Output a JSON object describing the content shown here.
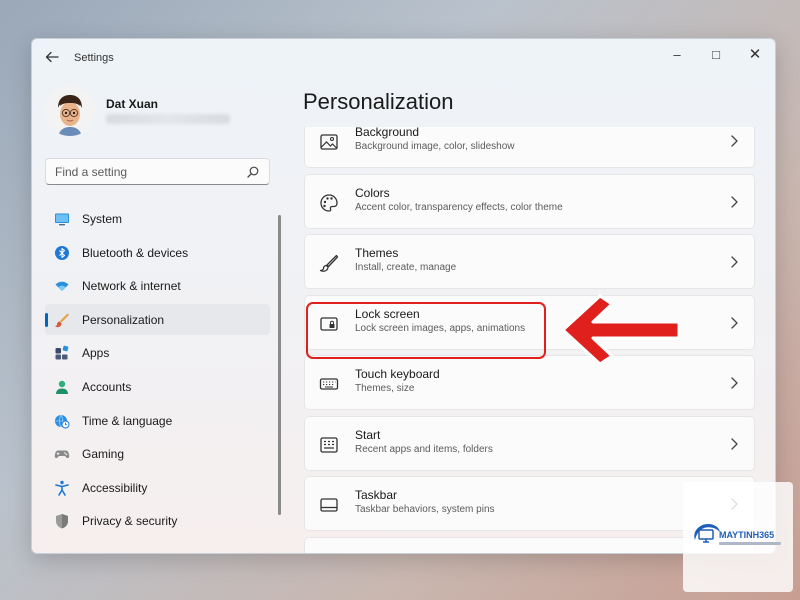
{
  "window": {
    "title": "Settings",
    "back_icon": "arrow-left-icon",
    "controls": {
      "minimize": "–",
      "maximize": "□",
      "close": "✕"
    }
  },
  "profile": {
    "name": "Dat Xuan"
  },
  "search": {
    "placeholder": "Find a setting",
    "icon": "search-icon"
  },
  "sidebar": {
    "items": [
      {
        "label": "System",
        "icon": "system-monitor-icon",
        "color": "#2a8fe0"
      },
      {
        "label": "Bluetooth & devices",
        "icon": "bluetooth-icon",
        "color": "#1e78d6"
      },
      {
        "label": "Network & internet",
        "icon": "wifi-icon",
        "color": "#2a8fe0"
      },
      {
        "label": "Personalization",
        "icon": "paintbrush-icon",
        "color": "#e07b3a",
        "active": true
      },
      {
        "label": "Apps",
        "icon": "apps-icon",
        "color": "#3a4a6a"
      },
      {
        "label": "Accounts",
        "icon": "account-icon",
        "color": "#2bb07a"
      },
      {
        "label": "Time & language",
        "icon": "globe-clock-icon",
        "color": "#2a8fe0"
      },
      {
        "label": "Gaming",
        "icon": "gamepad-icon",
        "color": "#7a7a7a"
      },
      {
        "label": "Accessibility",
        "icon": "accessibility-icon",
        "color": "#1e78d6"
      },
      {
        "label": "Privacy & security",
        "icon": "shield-icon",
        "color": "#8a8a8a"
      }
    ]
  },
  "main": {
    "title": "Personalization",
    "cards": [
      {
        "title": "Background",
        "subtitle": "Background image, color, slideshow",
        "icon": "image-icon"
      },
      {
        "title": "Colors",
        "subtitle": "Accent color, transparency effects, color theme",
        "icon": "palette-icon"
      },
      {
        "title": "Themes",
        "subtitle": "Install, create, manage",
        "icon": "brush-icon"
      },
      {
        "title": "Lock screen",
        "subtitle": "Lock screen images, apps, animations",
        "icon": "lock-screen-icon",
        "highlighted": true
      },
      {
        "title": "Touch keyboard",
        "subtitle": "Themes, size",
        "icon": "keyboard-icon"
      },
      {
        "title": "Start",
        "subtitle": "Recent apps and items, folders",
        "icon": "start-menu-icon"
      },
      {
        "title": "Taskbar",
        "subtitle": "Taskbar behaviors, system pins",
        "icon": "taskbar-icon"
      }
    ]
  },
  "annotation": {
    "highlight_color": "#e0201c",
    "arrow_icon": "red-arrow-left-icon"
  },
  "watermark": {
    "brand": "MAYTINH365"
  }
}
